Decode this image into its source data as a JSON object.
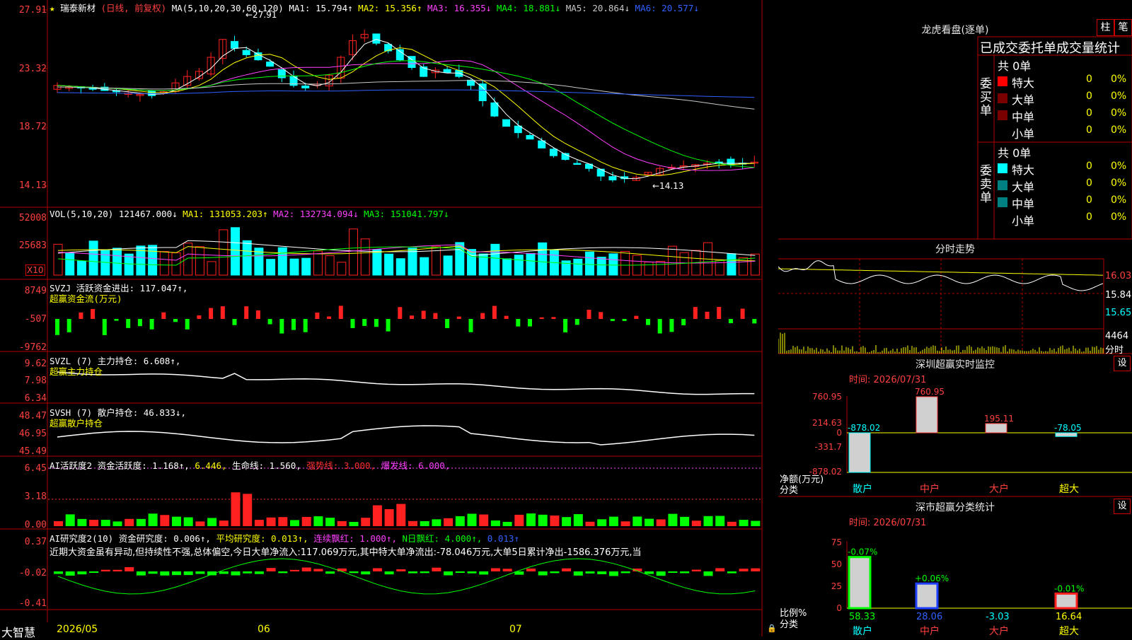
{
  "stock_header": {
    "star": "★",
    "name": "瑞泰新材",
    "mode": "(日线, 前复权)",
    "ma_params": "MA(5,10,20,30,60,120)",
    "ma1": "MA1: 15.794↑",
    "ma2": "MA2: 15.356↑",
    "ma3": "MA3: 16.355↓",
    "ma4": "MA4: 18.881↓",
    "ma5": "MA5: 20.864↓",
    "ma6": "MA6: 20.577↓"
  },
  "price_axis": [
    "27.91",
    "23.32",
    "18.72",
    "14.13"
  ],
  "price_high_label": "←27.91",
  "price_low_label": "←14.13",
  "vol_header": {
    "name": "VOL(5,10,20)",
    "val": "121467.000↓",
    "ma1": "MA1: 131053.203↑",
    "ma2": "MA2: 132734.094↓",
    "ma3": "MA3: 151041.797↓"
  },
  "vol_axis": [
    "52008",
    "25683"
  ],
  "vol_unit": "X10",
  "svzj": {
    "line1": "SVZJ  活跃资金进出: 117.047↑,",
    "line2": "超赢资金流(万元)",
    "axis": [
      "8749",
      "-507",
      "-9762"
    ]
  },
  "svzl": {
    "line1": "SVZL (7) 主力持仓: 6.608↑,",
    "line2": "超赢主力持仓",
    "axis": [
      "9.62",
      "7.98",
      "6.34"
    ]
  },
  "svsh": {
    "line1": "SVSH (7) 散户持仓: 46.833↓,",
    "line2": "超赢散户持仓",
    "axis": [
      "48.47",
      "46.95",
      "45.49"
    ]
  },
  "ai_active": {
    "p1": "AI活跃度2 资金活跃度: 1.168↑,",
    "p2": "6.446,",
    "p3": "生命线: 1.560,",
    "p4": "强势线: 3.000,",
    "p5": "爆发线: 6.000,",
    "axis": [
      "6.45",
      "3.18",
      "0.00"
    ]
  },
  "ai_research": {
    "p1": "AI研究度2(10) 资金研究度: 0.006↑,",
    "p2": "平均研究度: 0.013↑,",
    "p3": "连续飘红: 1.000↑,",
    "p4": "N日飘红: 4.000↑,",
    "p5": "0.013↑",
    "comment": "近期大资金虽有异动,但持续性不强,总体偏空,今日大单净流入:117.069万元,其中特大单净流出:-78.046万元,大单5日累计净出-1586.376万元,当",
    "axis": [
      "0.37",
      "-0.02",
      "-0.41"
    ]
  },
  "bottom_bar": {
    "brand": "大智慧",
    "d1": "2026/05",
    "d2": "06",
    "d3": "07"
  },
  "right_top": {
    "title": "龙虎看盘(逐单)",
    "btn_bar": "柱",
    "btn_item": "笔",
    "header": "已成交委托单成交量统计",
    "buy_label": "委买单",
    "sell_label": "委卖单",
    "buy_total": "共 0单",
    "sell_total": "共 0单",
    "buy_rows": [
      {
        "label": "特大",
        "count": "0",
        "pct": "0%",
        "color": "#ff0000"
      },
      {
        "label": "大单",
        "count": "0",
        "pct": "0%",
        "color": "#7a0000"
      },
      {
        "label": "中单",
        "count": "0",
        "pct": "0%",
        "color": "#7a0000"
      },
      {
        "label": "小单",
        "count": "0",
        "pct": "0%",
        "color": ""
      }
    ],
    "sell_rows": [
      {
        "label": "特大",
        "count": "0",
        "pct": "0%",
        "color": "#00ffff"
      },
      {
        "label": "大单",
        "count": "0",
        "pct": "0%",
        "color": "#008080"
      },
      {
        "label": "中单",
        "count": "0",
        "pct": "0%",
        "color": "#008080"
      },
      {
        "label": "小单",
        "count": "0",
        "pct": "0%",
        "color": ""
      }
    ]
  },
  "minute": {
    "title": "分时走势",
    "axis": [
      "16.03",
      "15.84",
      "15.65"
    ],
    "vol_axis": "4464",
    "unit": "分时"
  },
  "sz_monitor": {
    "title": "深圳超赢实时监控",
    "btn": "设",
    "time": "时间: 2026/07/31",
    "axis": [
      "760.95",
      "214.63",
      "0",
      "-331.7",
      "-878.02"
    ],
    "ylabel1": "净额(万元)",
    "ylabel2": "分类",
    "categories": [
      "散户",
      "中户",
      "大户",
      "超大"
    ],
    "values": [
      -878.02,
      760.95,
      195.11,
      -78.05
    ],
    "value_labels": [
      "-878.02",
      "760.95",
      "195.11",
      "-78.05"
    ]
  },
  "sz_classify": {
    "title": "深市超赢分类统计",
    "btn": "设",
    "time": "时间: 2026/07/31",
    "axis": [
      "75",
      "50",
      "25",
      "0"
    ],
    "ylabel1": "比例%",
    "ylabel2": "分类",
    "categories": [
      "散户",
      "中户",
      "大户",
      "超大"
    ],
    "values": [
      58.33,
      28.06,
      -3.03,
      16.64
    ],
    "value_labels": [
      "58.33",
      "28.06",
      "-3.03",
      "16.64"
    ],
    "change_labels": [
      "-0.07%",
      "+0.06%",
      "",
      "-0.01%"
    ]
  },
  "colors": {
    "up": "#ff2020",
    "down": "#00ffff",
    "green": "#00ff00",
    "yellow": "#ffff00",
    "magenta": "#ff40ff",
    "frame": "#b00000"
  }
}
